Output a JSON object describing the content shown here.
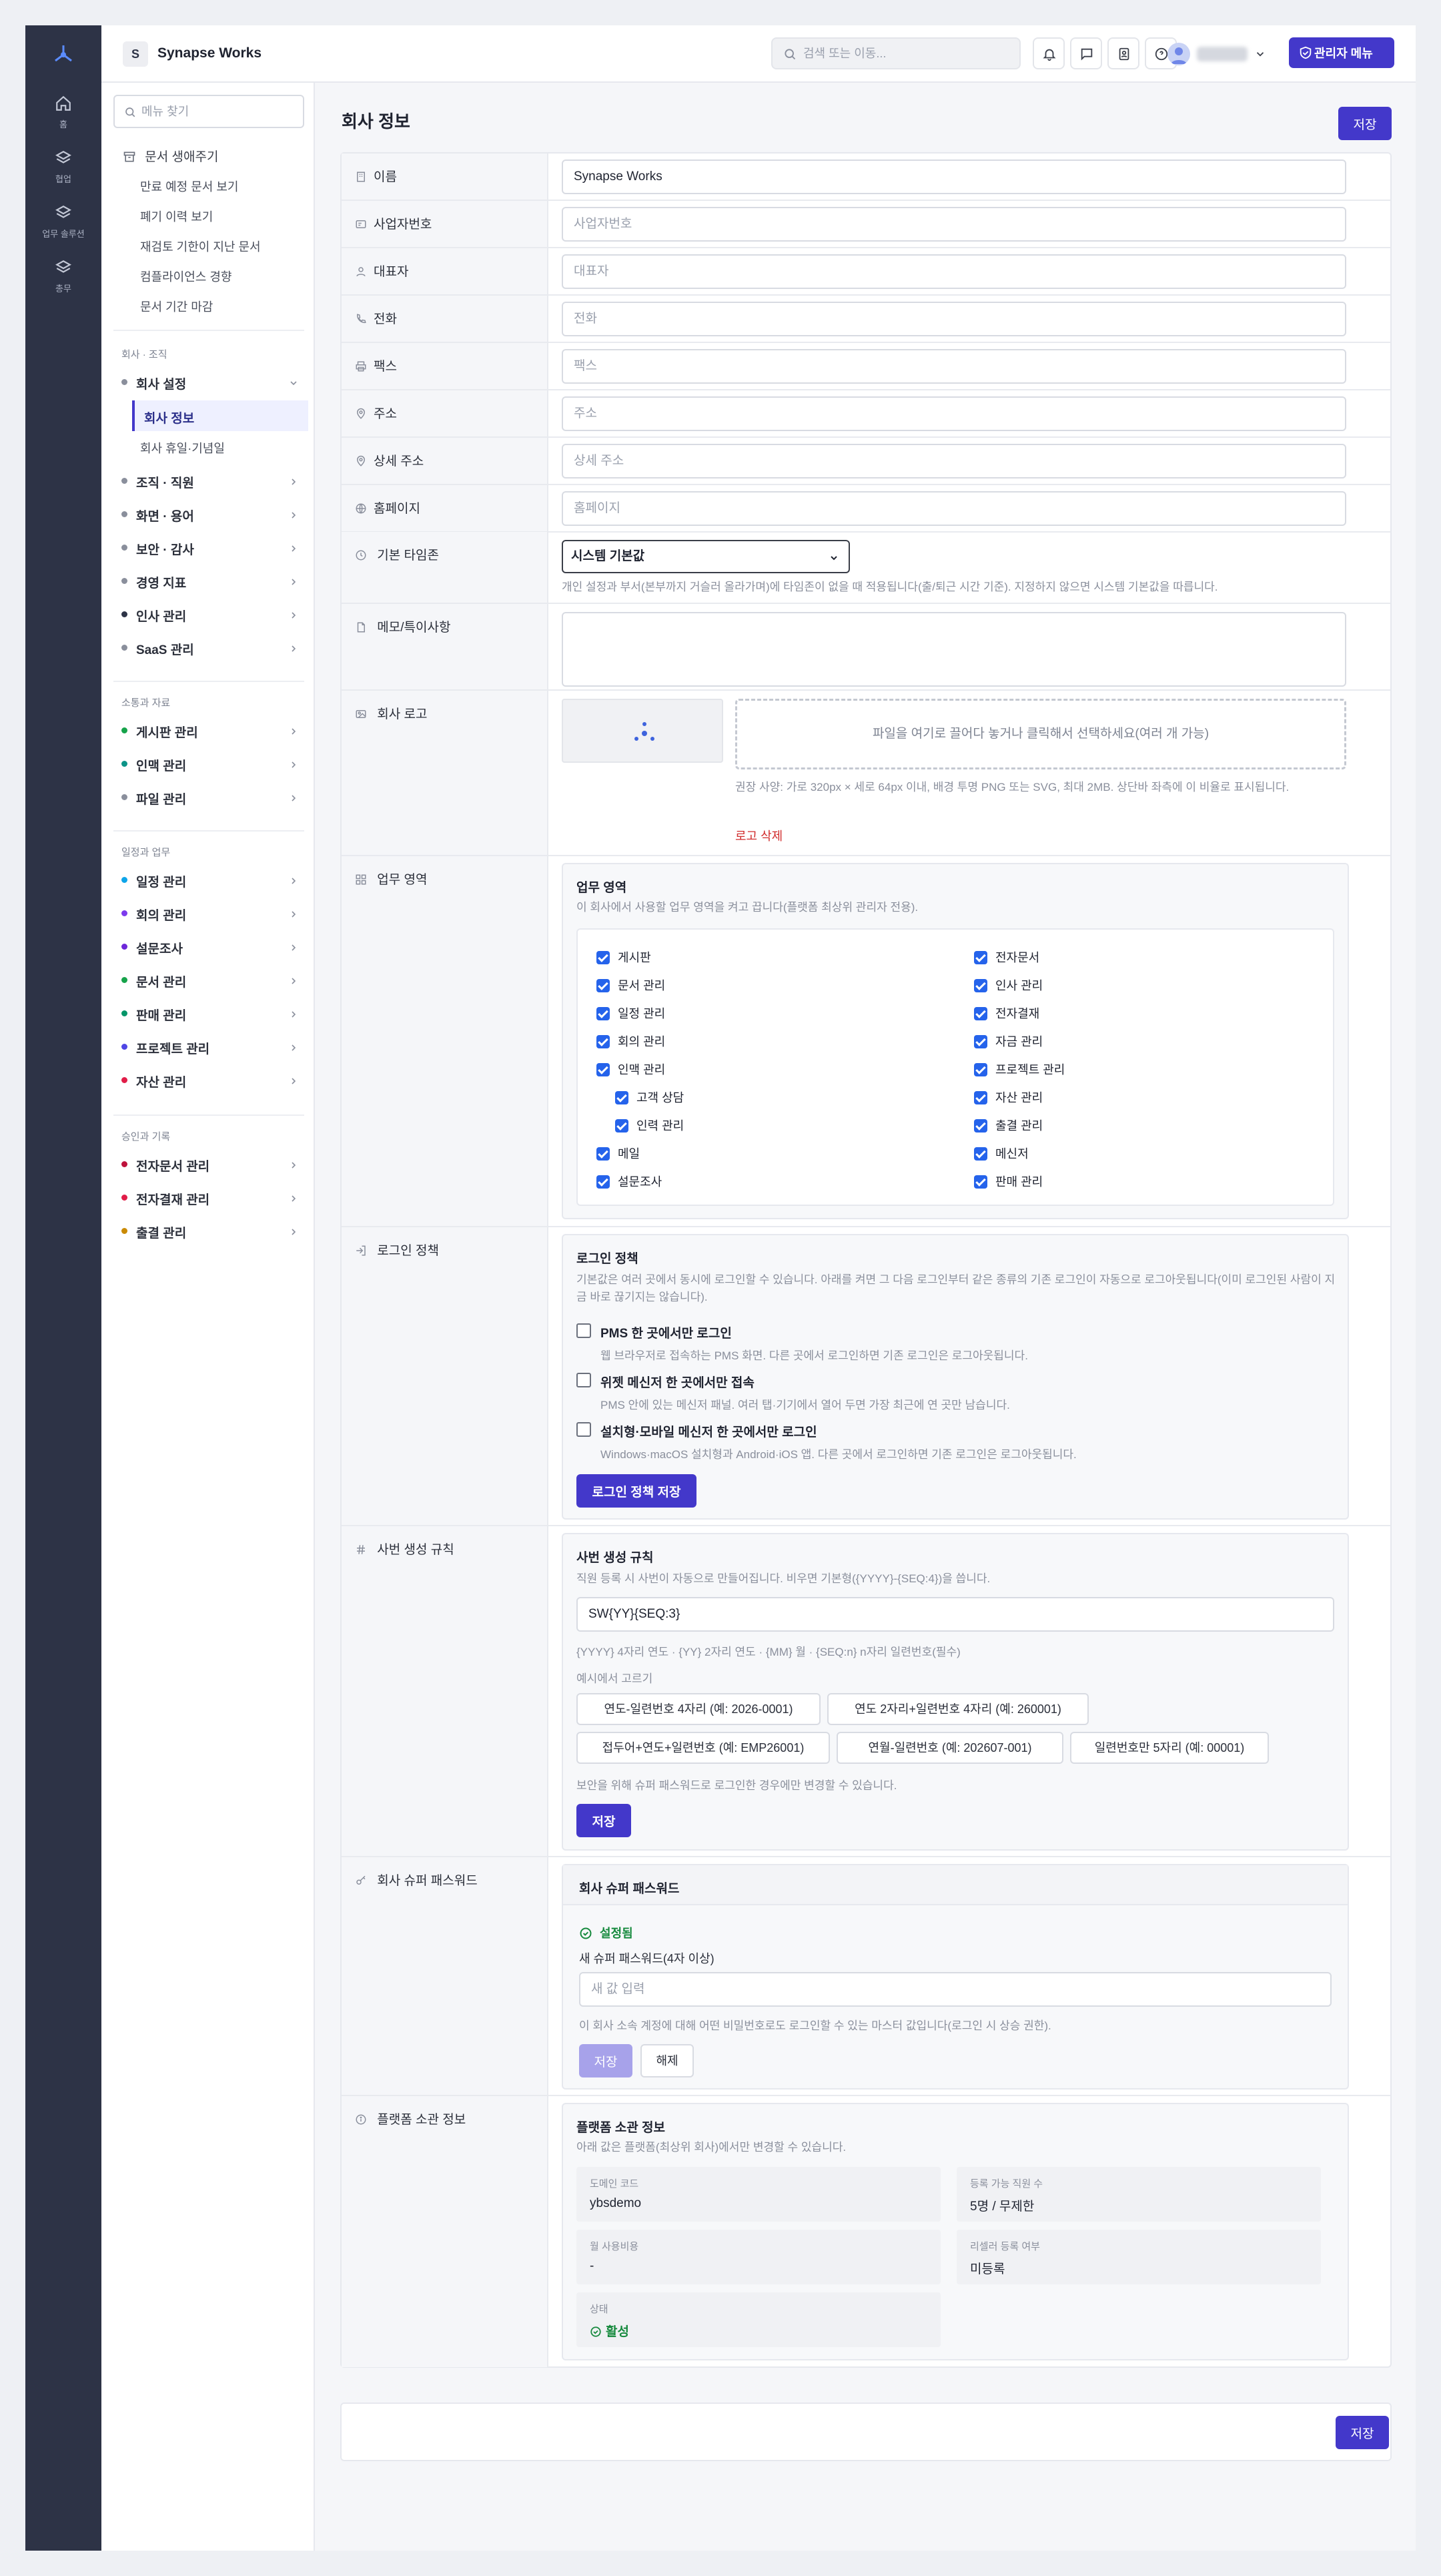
{
  "header": {
    "brand_initial": "S",
    "brand_name": "Synapse Works",
    "search_placeholder": "검색 또는 이동...",
    "admin_menu": "관리자 메뉴"
  },
  "rail": [
    {
      "label": "홈",
      "icon": "home-icon"
    },
    {
      "label": "협업",
      "icon": "layers-icon"
    },
    {
      "label": "업무 솔루션",
      "icon": "layers-icon"
    },
    {
      "label": "총무",
      "icon": "layers-icon"
    }
  ],
  "sidebar": {
    "search_placeholder": "메뉴 찾기",
    "doc_lifecycle": "문서 생애주기",
    "doc_subs": [
      "만료 예정 문서 보기",
      "폐기 이력 보기",
      "재검토 기한이 지난 문서",
      "컴플라이언스 경향",
      "문서 기간 마감"
    ],
    "sec_company": "회사 · 조직",
    "company_settings": "회사 설정",
    "company_info": "회사 정보",
    "holidays": "회사 휴일·기념일",
    "group1": [
      {
        "label": "조직 · 직원",
        "color": "#8a8f9c"
      },
      {
        "label": "화면 · 용어",
        "color": "#8a8f9c"
      },
      {
        "label": "보안 · 감사",
        "color": "#8a8f9c"
      },
      {
        "label": "경영 지표",
        "color": "#8a8f9c"
      },
      {
        "label": "인사 관리",
        "color": "#2d3346"
      },
      {
        "label": "SaaS 관리",
        "color": "#8a8f9c"
      }
    ],
    "sec_comm": "소통과 자료",
    "group2": [
      {
        "label": "게시판 관리",
        "color": "#16a34a"
      },
      {
        "label": "인맥 관리",
        "color": "#0d9488"
      },
      {
        "label": "파일 관리",
        "color": "#8a8f9c"
      }
    ],
    "sec_work": "일정과 업무",
    "group3": [
      {
        "label": "일정 관리",
        "color": "#0ea5e9"
      },
      {
        "label": "회의 관리",
        "color": "#7c3aed"
      },
      {
        "label": "설문조사",
        "color": "#6d28d9"
      },
      {
        "label": "문서 관리",
        "color": "#16a34a"
      },
      {
        "label": "판매 관리",
        "color": "#059669"
      },
      {
        "label": "프로젝트 관리",
        "color": "#4f46e5"
      },
      {
        "label": "자산 관리",
        "color": "#e11d48"
      }
    ],
    "sec_approval": "승인과 기록",
    "group4": [
      {
        "label": "전자문서 관리",
        "color": "#be123c"
      },
      {
        "label": "전자결재 관리",
        "color": "#e11d48"
      },
      {
        "label": "출결 관리",
        "color": "#ca8a04"
      }
    ]
  },
  "page": {
    "title": "회사 정보",
    "save": "저장"
  },
  "fields": [
    {
      "label": "이름",
      "icon": "building-icon",
      "value": "Synapse Works",
      "placeholder": ""
    },
    {
      "label": "사업자번호",
      "icon": "id-card-icon",
      "value": "",
      "placeholder": "사업자번호"
    },
    {
      "label": "대표자",
      "icon": "user-icon",
      "value": "",
      "placeholder": "대표자"
    },
    {
      "label": "전화",
      "icon": "phone-icon",
      "value": "",
      "placeholder": "전화"
    },
    {
      "label": "팩스",
      "icon": "printer-icon",
      "value": "",
      "placeholder": "팩스"
    },
    {
      "label": "주소",
      "icon": "map-pin-icon",
      "value": "",
      "placeholder": "주소"
    },
    {
      "label": "상세 주소",
      "icon": "map-pin-icon",
      "value": "",
      "placeholder": "상세 주소"
    },
    {
      "label": "홈페이지",
      "icon": "globe-icon",
      "value": "",
      "placeholder": "홈페이지"
    }
  ],
  "timezone": {
    "label": "기본 타임존",
    "selected": "시스템 기본값",
    "hint": "개인 설정과 부서(본부까지 거슬러 올라가며)에 타임존이 없을 때 적용됩니다(출/퇴근 시간 기준). 지정하지 않으면 시스템 기본값을 따릅니다."
  },
  "memo": {
    "label": "메모/특이사항"
  },
  "logo": {
    "label": "회사 로고",
    "dropzone": "파일을 여기로 끌어다 놓거나 클릭해서 선택하세요(여러 개 가능)",
    "hint": "권장 사양: 가로 320px × 세로 64px 이내, 배경 투명 PNG 또는 SVG, 최대 2MB. 상단바 좌측에 이 비율로 표시됩니다.",
    "delete": "로고 삭제"
  },
  "modules": {
    "label": "업무 영역",
    "title": "업무 영역",
    "desc": "이 회사에서 사용할 업무 영역을 켜고 끕니다(플랫폼 최상위 관리자 전용).",
    "left": [
      "게시판",
      "문서 관리",
      "일정 관리",
      "회의 관리",
      "인맥 관리",
      "고객 상담",
      "인력 관리",
      "메일",
      "설문조사"
    ],
    "right": [
      "전자문서",
      "인사 관리",
      "전자결재",
      "자금 관리",
      "프로젝트 관리",
      "자산 관리",
      "출결 관리",
      "메신저",
      "판매 관리"
    ]
  },
  "login": {
    "label": "로그인 정책",
    "title": "로그인 정책",
    "desc": "기본값은 여러 곳에서 동시에 로그인할 수 있습니다. 아래를 켜면 그 다음 로그인부터 같은 종류의 기존 로그인이 자동으로 로그아웃됩니다(이미 로그인된 사람이 지금 바로 끊기지는 않습니다).",
    "options": [
      {
        "title": "PMS 한 곳에서만 로그인",
        "desc": "웹 브라우저로 접속하는 PMS 화면. 다른 곳에서 로그인하면 기존 로그인은 로그아웃됩니다."
      },
      {
        "title": "위젯 메신저 한 곳에서만 접속",
        "desc": "PMS 안에 있는 메신저 패널. 여러 탭·기기에서 열어 두면 가장 최근에 연 곳만 남습니다."
      },
      {
        "title": "설치형·모바일 메신저 한 곳에서만 로그인",
        "desc": "Windows·macOS 설치형과 Android·iOS 앱. 다른 곳에서 로그인하면 기존 로그인은 로그아웃됩니다."
      }
    ],
    "save": "로그인 정책 저장"
  },
  "empno": {
    "label": "사번 생성 규칙",
    "title": "사번 생성 규칙",
    "desc": "직원 등록 시 사번이 자동으로 만들어집니다. 비우면 기본형({YYYY}-{SEQ:4})을 씁니다.",
    "value": "SW{YY}{SEQ:3}",
    "tokens": "{YYYY} 4자리 연도 · {YY} 2자리 연도 · {MM} 월 · {SEQ:n} n자리 일련번호(필수)",
    "examples_title": "예시에서 고르기",
    "examples": [
      "연도-일련번호 4자리 (예: 2026-0001)",
      "연도 2자리+일련번호 4자리 (예: 260001)",
      "접두어+연도+일련번호 (예: EMP26001)",
      "연월-일련번호 (예: 202607-001)",
      "일련번호만 5자리 (예: 00001)"
    ],
    "note": "보안을 위해 슈퍼 패스워드로 로그인한 경우에만 변경할 수 있습니다.",
    "save": "저장"
  },
  "superpw": {
    "label": "회사 슈퍼 패스워드",
    "head": "회사 슈퍼 패스워드",
    "status": "설정됨",
    "new_label": "새 슈퍼 패스워드(4자 이상)",
    "placeholder": "새 값 입력",
    "hint": "이 회사 소속 계정에 대해 어떤 비밀번호로도 로그인할 수 있는 마스터 값입니다(로그인 시 상승 권한).",
    "save": "저장",
    "clear": "해제"
  },
  "platform": {
    "label": "플랫폼 소관 정보",
    "title": "플랫폼 소관 정보",
    "desc": "아래 값은 플랫폼(최상위 회사)에서만 변경할 수 있습니다.",
    "domain_k": "도메인 코드",
    "domain_v": "ybsdemo",
    "seats_k": "등록 가능 직원 수",
    "seats_v": "5명 / 무제한",
    "fee_k": "월 사용비용",
    "fee_v": "-",
    "reseller_k": "리셀러 등록 여부",
    "reseller_v": "미등록",
    "status_k": "상태",
    "status_v": "활성"
  },
  "colors": {
    "accent": "#4338ca",
    "success": "#178a3e",
    "danger": "#d12c2c",
    "rail": "#2d3346"
  }
}
